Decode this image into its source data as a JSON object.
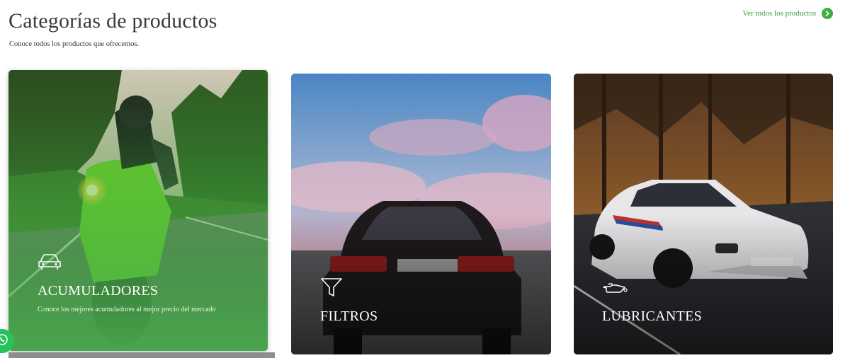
{
  "header": {
    "title": "Categorías de productos",
    "subtitle": "Conoce todos los productos que ofrecemos.",
    "view_all_label": "Ver todos los productos",
    "view_all_icon": "chevron-right-icon"
  },
  "categories": [
    {
      "title": "ACUMULADORES",
      "description": "Conoce los mejores acumuladores al mejor precio del mercado",
      "icon": "car-icon"
    },
    {
      "title": "FILTROS",
      "icon": "funnel-filter-icon"
    },
    {
      "title": "LUBRICANTES",
      "icon": "oil-can-icon"
    }
  ],
  "colors": {
    "accent_green": "#3fae3f",
    "overlay_green": "#4caf50",
    "title_text": "#3a3a3a"
  },
  "floating": {
    "whatsapp_icon": "whatsapp-icon"
  }
}
